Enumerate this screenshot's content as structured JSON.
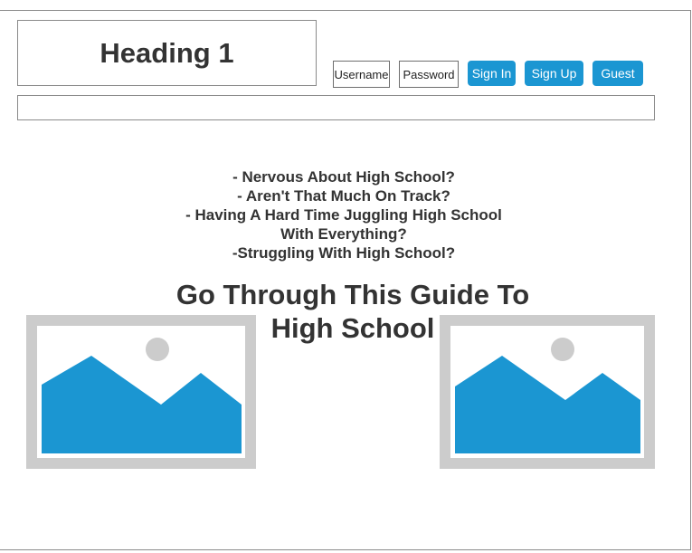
{
  "header": {
    "heading": "Heading 1",
    "username_placeholder": "Username",
    "password_placeholder": "Password",
    "sign_in_label": "Sign In",
    "sign_up_label": "Sign Up",
    "guest_label": "Guest"
  },
  "main": {
    "questions": [
      "- Nervous About High School?",
      "- Aren't That Much On Track?",
      "- Having A  Hard Time Juggling High School",
      "With Everything?",
      "-Struggling With High School?"
    ],
    "guide_line1": "Go Through This Guide To",
    "guide_line2": "High School"
  },
  "images": [
    {
      "icon": "image-placeholder-icon"
    },
    {
      "icon": "image-placeholder-icon"
    }
  ],
  "colors": {
    "accent": "#1b96d2",
    "placeholder_frame": "#cccccc",
    "text": "#333333"
  }
}
